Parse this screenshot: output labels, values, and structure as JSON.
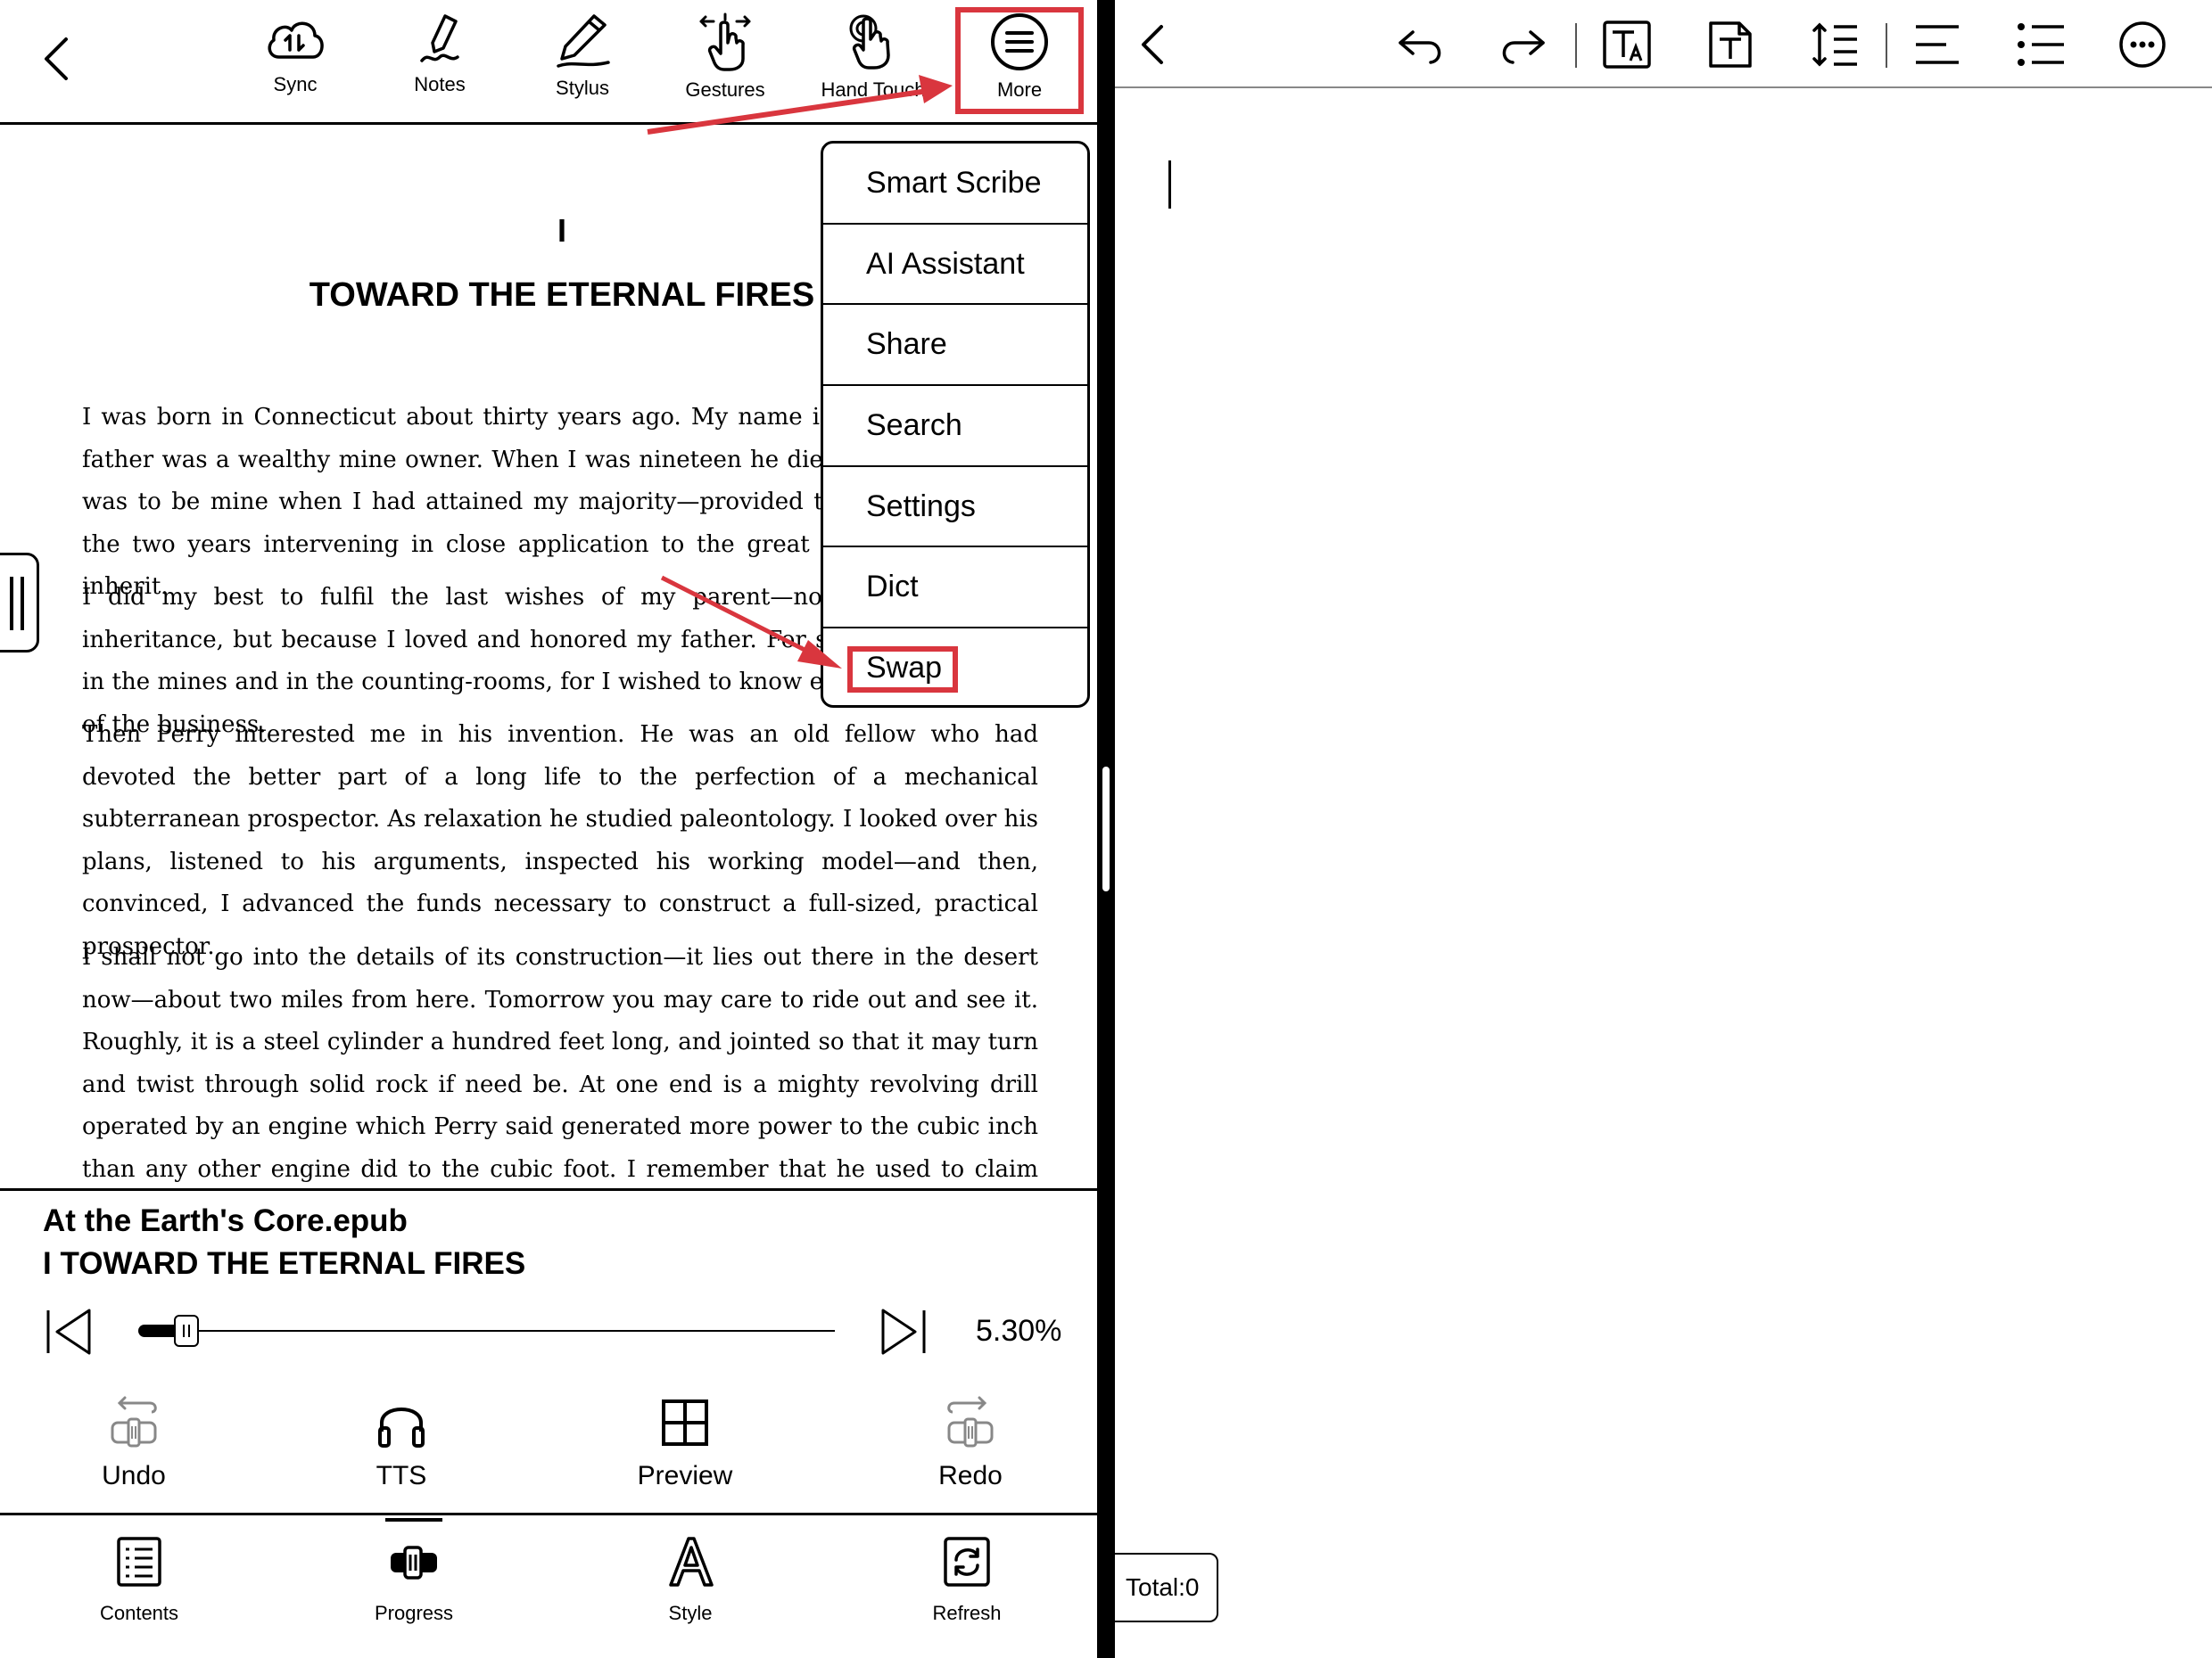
{
  "toolbar": {
    "items": [
      {
        "label": "Sync",
        "icon": "cloud-sync-icon"
      },
      {
        "label": "Notes",
        "icon": "notes-icon"
      },
      {
        "label": "Stylus",
        "icon": "stylus-icon"
      },
      {
        "label": "Gestures",
        "icon": "gestures-icon"
      },
      {
        "label": "Hand Touch",
        "icon": "hand-touch-icon"
      },
      {
        "label": "More",
        "icon": "more-menu-icon"
      }
    ]
  },
  "content": {
    "chapter_number": "I",
    "chapter_title": "TOWARD THE ETERNAL FIRES",
    "paragraphs": [
      "I was born in Connecticut about thirty years ago. My name is David Innes. My father was a wealthy mine owner. When I was nineteen he died. All his property was to be mine when I had attained my majority—provided that I had devoted the two years intervening in close application to the great business I was to inherit.",
      "I did my best to fulfil the last wishes of my parent—not because of the inheritance, but because I loved and honored my father. For six months I toiled in the mines and in the counting-rooms, for I wished to know every minute detail of the business.",
      "Then Perry interested me in his invention. He was an old fellow who had devoted the better part of a long life to the perfection of a mechanical subterranean prospector. As relaxation he studied paleontology. I looked over his plans, listened to his arguments, inspected his working model—and then, convinced, I advanced the funds necessary to construct a full-sized, practical prospector.",
      "I shall not go into the details of its construction—it lies out there in the desert now—about two miles from here. Tomorrow you may care to ride out and see it. Roughly, it is a steel cylinder a hundred feet long, and jointed so that it may turn and twist through solid rock if need be. At one end is a mighty revolving drill operated by an engine which Perry said generated more power to the cubic inch than any other engine did to the cubic foot. I remember that he used to claim that that invention"
    ]
  },
  "more_menu": {
    "items": [
      "Smart Scribe",
      "AI Assistant",
      "Share",
      "Search",
      "Settings",
      "Dict",
      "Swap"
    ]
  },
  "reading_panel": {
    "book_title": "At the Earth's Core.epub",
    "chapter": "I TOWARD THE ETERNAL FIRES",
    "progress_percent_label": "5.30%",
    "progress_fraction": 0.053,
    "controls": [
      {
        "label": "Undo",
        "icon": "undo-progress-icon",
        "disabled": true
      },
      {
        "label": "TTS",
        "icon": "headphones-icon",
        "disabled": false
      },
      {
        "label": "Preview",
        "icon": "grid-preview-icon",
        "disabled": false
      },
      {
        "label": "Redo",
        "icon": "redo-progress-icon",
        "disabled": true
      }
    ]
  },
  "bottom_nav": {
    "items": [
      {
        "label": "Contents",
        "icon": "contents-icon"
      },
      {
        "label": "Progress",
        "icon": "progress-icon"
      },
      {
        "label": "Style",
        "icon": "style-icon"
      },
      {
        "label": "Refresh",
        "icon": "refresh-icon"
      }
    ]
  },
  "right_editor": {
    "total_label": "Total:0",
    "icons": [
      "back-icon",
      "undo-icon",
      "redo-icon",
      "text-format-icon",
      "text-box-icon",
      "line-spacing-icon",
      "align-icon",
      "bullet-list-icon",
      "more-options-icon"
    ]
  },
  "colors": {
    "annotation_red": "#d9363e",
    "disabled_gray": "#888888"
  }
}
